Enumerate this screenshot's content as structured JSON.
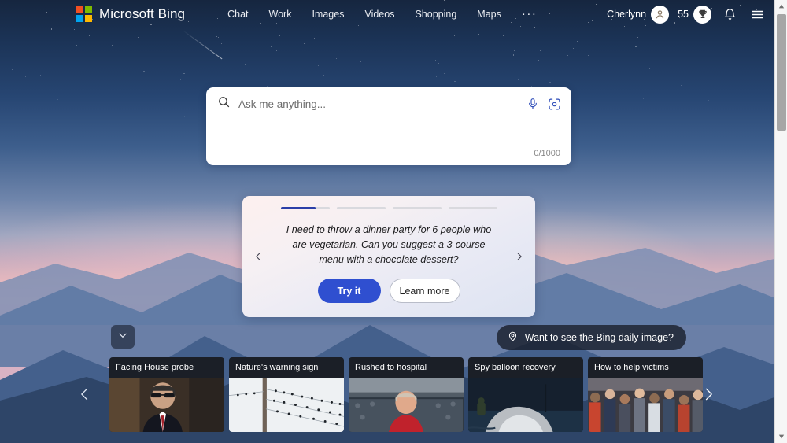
{
  "header": {
    "brand": "Microsoft Bing",
    "logo_icon": "microsoft-logo-icon",
    "logo_colors": [
      "#f25022",
      "#7fba00",
      "#00a4ef",
      "#ffb900"
    ],
    "nav": [
      {
        "label": "Chat"
      },
      {
        "label": "Work"
      },
      {
        "label": "Images"
      },
      {
        "label": "Videos"
      },
      {
        "label": "Shopping"
      },
      {
        "label": "Maps"
      }
    ],
    "more_label": "···",
    "user_name": "Cherlynn",
    "avatar_icon": "person-avatar-icon",
    "rewards_count": "55",
    "rewards_icon": "trophy-icon",
    "notifications_icon": "bell-icon",
    "menu_icon": "hamburger-menu-icon"
  },
  "search": {
    "placeholder": "Ask me anything...",
    "value": "",
    "search_icon": "search-icon",
    "mic_icon": "microphone-icon",
    "lens_icon": "visual-search-camera-icon",
    "char_count": "0/1000"
  },
  "suggestion": {
    "progress": [
      {
        "fill_percent": 72
      },
      {
        "fill_percent": 0
      },
      {
        "fill_percent": 0
      },
      {
        "fill_percent": 0
      }
    ],
    "text": "I need to throw a dinner party for 6 people who are vegetarian. Can you suggest a 3-course menu with a chocolate dessert?",
    "try_label": "Try it",
    "learn_label": "Learn more",
    "prev_icon": "chevron-left-icon",
    "next_icon": "chevron-right-icon",
    "primary_color": "#2f4fd0"
  },
  "controls": {
    "collapse_icon": "chevron-down-icon",
    "daily_image_label": "Want to see the Bing daily image?",
    "daily_image_icon": "location-pin-icon",
    "carousel_prev_icon": "chevron-left-icon",
    "carousel_next_icon": "chevron-right-icon"
  },
  "cards": [
    {
      "title": "Facing House probe"
    },
    {
      "title": "Nature's warning sign"
    },
    {
      "title": "Rushed to hospital"
    },
    {
      "title": "Spy balloon recovery"
    },
    {
      "title": "How to help victims"
    }
  ],
  "scrollbar": {
    "up_icon": "scroll-up-arrow-icon",
    "down_icon": "scroll-down-arrow-icon"
  }
}
